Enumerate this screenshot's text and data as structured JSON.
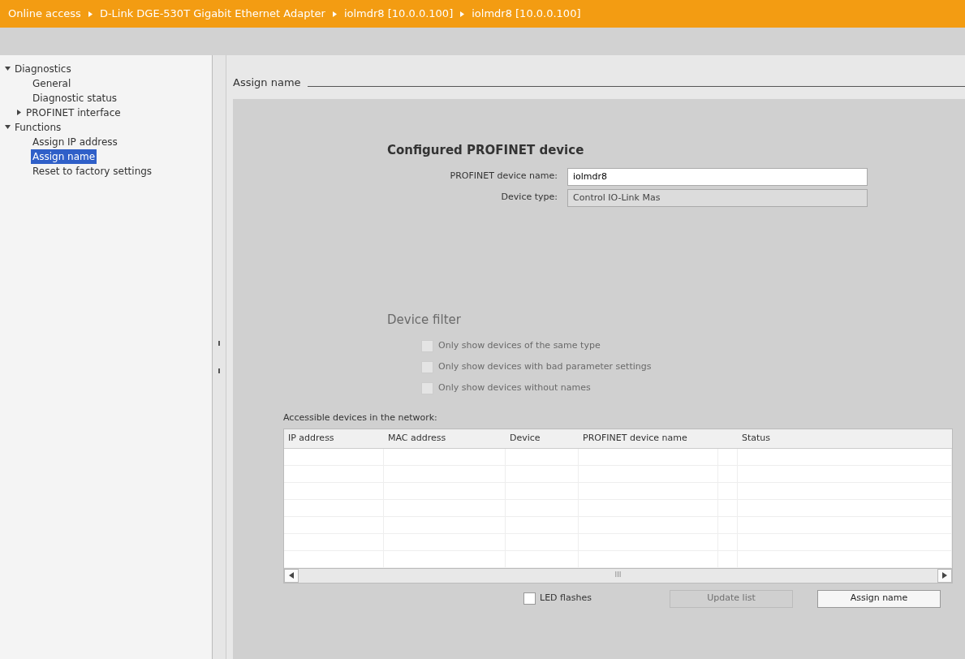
{
  "breadcrumb": [
    "Online access",
    "D-Link DGE-530T Gigabit Ethernet Adapter",
    "iolmdr8 [10.0.0.100]",
    "iolmdr8 [10.0.0.100]"
  ],
  "sidebar": {
    "items": [
      {
        "label": "Diagnostics",
        "expanded": true,
        "selected": false,
        "children": [
          {
            "label": "General",
            "selected": false
          },
          {
            "label": "Diagnostic status",
            "selected": false
          },
          {
            "label": "PROFINET interface",
            "expanded": false,
            "selected": false
          }
        ]
      },
      {
        "label": "Functions",
        "expanded": true,
        "selected": false,
        "children": [
          {
            "label": "Assign IP address",
            "selected": false
          },
          {
            "label": "Assign name",
            "selected": true
          },
          {
            "label": "Reset to factory settings",
            "selected": false
          }
        ]
      }
    ]
  },
  "section_title": "Assign name",
  "configured": {
    "title": "Configured PROFINET device",
    "fields": [
      {
        "label": "PROFINET device name:",
        "value": "iolmdr8",
        "disabled": false
      },
      {
        "label": "Device type:",
        "value": "Control IO-Link Mas",
        "disabled": true
      }
    ]
  },
  "device_filter": {
    "title": "Device filter",
    "disabled": true,
    "options": [
      {
        "label": "Only show devices of the same type",
        "checked": false
      },
      {
        "label": "Only show devices with bad parameter settings",
        "checked": false
      },
      {
        "label": "Only show devices without names",
        "checked": false
      }
    ]
  },
  "table": {
    "caption": "Accessible devices in the network:",
    "columns": [
      "IP address",
      "MAC address",
      "Device",
      "PROFINET device name",
      "",
      "Status"
    ]
  },
  "scroll_thumb": "III",
  "led_flashes": {
    "label": "LED flashes",
    "checked": false
  },
  "buttons": [
    {
      "label": "Update list",
      "disabled": true
    },
    {
      "label": "Assign name",
      "disabled": false
    }
  ]
}
